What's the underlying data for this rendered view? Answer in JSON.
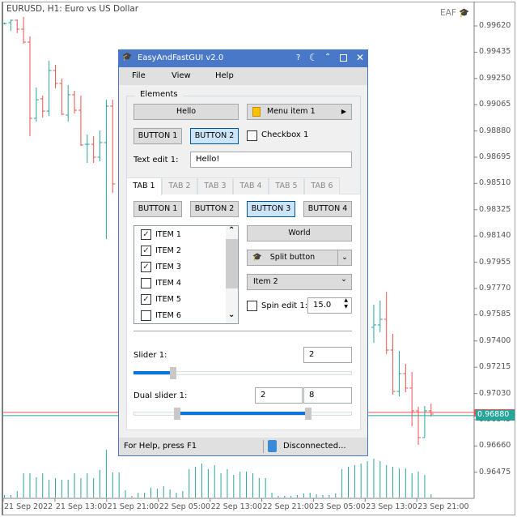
{
  "chart_header": {
    "title": "EURUSD, H1:  Euro vs US Dollar",
    "badge": "EAF"
  },
  "chart_data": {
    "type": "ohlc",
    "symbol": "EURUSD",
    "timeframe": "H1",
    "y_ticks": [
      "0.99620",
      "0.99435",
      "0.99250",
      "0.99065",
      "0.98880",
      "0.98695",
      "0.98510",
      "0.98325",
      "0.98140",
      "0.97955",
      "0.97770",
      "0.97585",
      "0.97400",
      "0.97215",
      "0.97030",
      "0.96845",
      "0.96660",
      "0.96475"
    ],
    "x_ticks": [
      "21 Sep 2022",
      "21 Sep 13:00",
      "21 Sep 21:00",
      "22 Sep 05:00",
      "22 Sep 13:00",
      "22 Sep 21:00",
      "23 Sep 05:00",
      "23 Sep 13:00",
      "23 Sep 21:00"
    ],
    "bid": "0.96880",
    "ask": 0.96897,
    "bars": [
      {
        "i": 0,
        "o": 0.99637,
        "h": 0.99643,
        "l": 0.99631,
        "c": 0.99637
      },
      {
        "i": 1,
        "o": 0.99643,
        "h": 0.99666,
        "l": 0.99586,
        "c": 0.9966
      },
      {
        "i": 2,
        "o": 0.9966,
        "h": 0.99666,
        "l": 0.99569,
        "c": 0.99597
      },
      {
        "i": 3,
        "o": 0.99597,
        "h": 0.99683,
        "l": 0.99494,
        "c": 0.99506
      },
      {
        "i": 4,
        "o": 0.99506,
        "h": 0.99546,
        "l": 0.98844,
        "c": 0.98969
      },
      {
        "i": 5,
        "o": 0.98969,
        "h": 0.99186,
        "l": 0.98946,
        "c": 0.991
      },
      {
        "i": 6,
        "o": 0.99106,
        "h": 0.99129,
        "l": 0.98975,
        "c": 0.9902
      },
      {
        "i": 7,
        "o": 0.9902,
        "h": 0.99374,
        "l": 0.98986,
        "c": 0.99306
      },
      {
        "i": 8,
        "o": 0.99306,
        "h": 0.99346,
        "l": 0.9918,
        "c": 0.99215
      },
      {
        "i": 9,
        "o": 0.99215,
        "h": 0.99249,
        "l": 0.98992,
        "c": 0.98998
      },
      {
        "i": 10,
        "o": 0.98992,
        "h": 0.99203,
        "l": 0.98946,
        "c": 0.99135
      },
      {
        "i": 11,
        "o": 0.99135,
        "h": 0.99163,
        "l": 0.99003,
        "c": 0.99026
      },
      {
        "i": 12,
        "o": 0.99026,
        "h": 0.99129,
        "l": 0.98775,
        "c": 0.98781
      },
      {
        "i": 13,
        "o": 0.98786,
        "h": 0.98855,
        "l": 0.98655,
        "c": 0.98786
      },
      {
        "i": 14,
        "o": 0.98786,
        "h": 0.98843,
        "l": 0.98655,
        "c": 0.98695
      },
      {
        "i": 15,
        "o": 0.98695,
        "h": 0.98883,
        "l": 0.98666,
        "c": 0.98798
      },
      {
        "i": 16,
        "o": 0.98798,
        "h": 0.991,
        "l": 0.98118,
        "c": 0.99055
      },
      {
        "i": 17,
        "o": 0.99055,
        "h": 0.991,
        "l": 0.98444,
        "c": 0.98507
      },
      {
        "i": 58,
        "o": 0.97496,
        "h": 0.97656,
        "l": 0.97387,
        "c": 0.97513
      },
      {
        "i": 59,
        "o": 0.97513,
        "h": 0.97684,
        "l": 0.97462,
        "c": 0.97553
      },
      {
        "i": 60,
        "o": 0.97553,
        "h": 0.97747,
        "l": 0.97307,
        "c": 0.97336
      },
      {
        "i": 61,
        "o": 0.97336,
        "h": 0.9745,
        "l": 0.97022,
        "c": 0.97045
      },
      {
        "i": 62,
        "o": 0.97045,
        "h": 0.9733,
        "l": 0.9701,
        "c": 0.9717
      },
      {
        "i": 63,
        "o": 0.9717,
        "h": 0.97239,
        "l": 0.97039,
        "c": 0.97068
      },
      {
        "i": 64,
        "o": 0.97068,
        "h": 0.97182,
        "l": 0.96799,
        "c": 0.96908
      },
      {
        "i": 65,
        "o": 0.96908,
        "h": 0.96936,
        "l": 0.96668,
        "c": 0.96719
      },
      {
        "i": 66,
        "o": 0.96719,
        "h": 0.96942,
        "l": 0.96719,
        "c": 0.96908
      },
      {
        "i": 67,
        "o": 0.96908,
        "h": 0.96959,
        "l": 0.96868,
        "c": 0.96885
      }
    ],
    "volumes": [
      3,
      3,
      8,
      30,
      30,
      25,
      30,
      22,
      24,
      22,
      22,
      30,
      24,
      30,
      24,
      34,
      59,
      31,
      31,
      9,
      2,
      6,
      6,
      12,
      11,
      14,
      10,
      6,
      8,
      35,
      38,
      42,
      35,
      40,
      30,
      35,
      28,
      32,
      32,
      30,
      24,
      24,
      6,
      2,
      2,
      2,
      3,
      5,
      6,
      4,
      3,
      3,
      5,
      35,
      38,
      40,
      42,
      45,
      48,
      45,
      40,
      38,
      36,
      36,
      30,
      32,
      28,
      4
    ],
    "colors": {
      "up": "#26a69a",
      "down": "#ef5350",
      "volume": "#26a69a"
    }
  },
  "dialog": {
    "title": "EasyAndFastGUI v2.0",
    "title_buttons": {
      "help": "?"
    },
    "menu": [
      "File",
      "View",
      "Help"
    ],
    "group_label": "Elements",
    "hello_button": "Hello",
    "menu_item": "Menu item 1",
    "button1": "BUTTON 1",
    "button2": "BUTTON 2",
    "checkbox1": "Checkbox 1",
    "text_edit_label": "Text edit 1:",
    "text_edit_value": "Hello!",
    "tabs": [
      "TAB 1",
      "TAB 2",
      "TAB 3",
      "TAB 4",
      "TAB 5",
      "TAB 6"
    ],
    "tab_buttons": [
      "BUTTON 1",
      "BUTTON 2",
      "BUTTON 3",
      "BUTTON 4"
    ],
    "list_items": [
      {
        "label": "ITEM 1",
        "checked": true
      },
      {
        "label": "ITEM 2",
        "checked": true
      },
      {
        "label": "ITEM 3",
        "checked": true
      },
      {
        "label": "ITEM 4",
        "checked": false
      },
      {
        "label": "ITEM 5",
        "checked": true
      },
      {
        "label": "ITEM 6",
        "checked": false
      }
    ],
    "world_button": "World",
    "split_button": "Split button",
    "combo_value": "Item 2",
    "spin_label": "Spin edit 1:",
    "spin_value": "15.0",
    "slider_label": "Slider 1:",
    "slider_value": "2",
    "slider_fraction": 0.18,
    "dual_label": "Dual slider 1:",
    "dual_low": "2",
    "dual_high": "8",
    "dual_low_fraction": 0.2,
    "dual_high_fraction": 0.8,
    "status_help": "For Help, press F1",
    "status_conn": "Disconnected...",
    "accent": "#4a78c8"
  }
}
